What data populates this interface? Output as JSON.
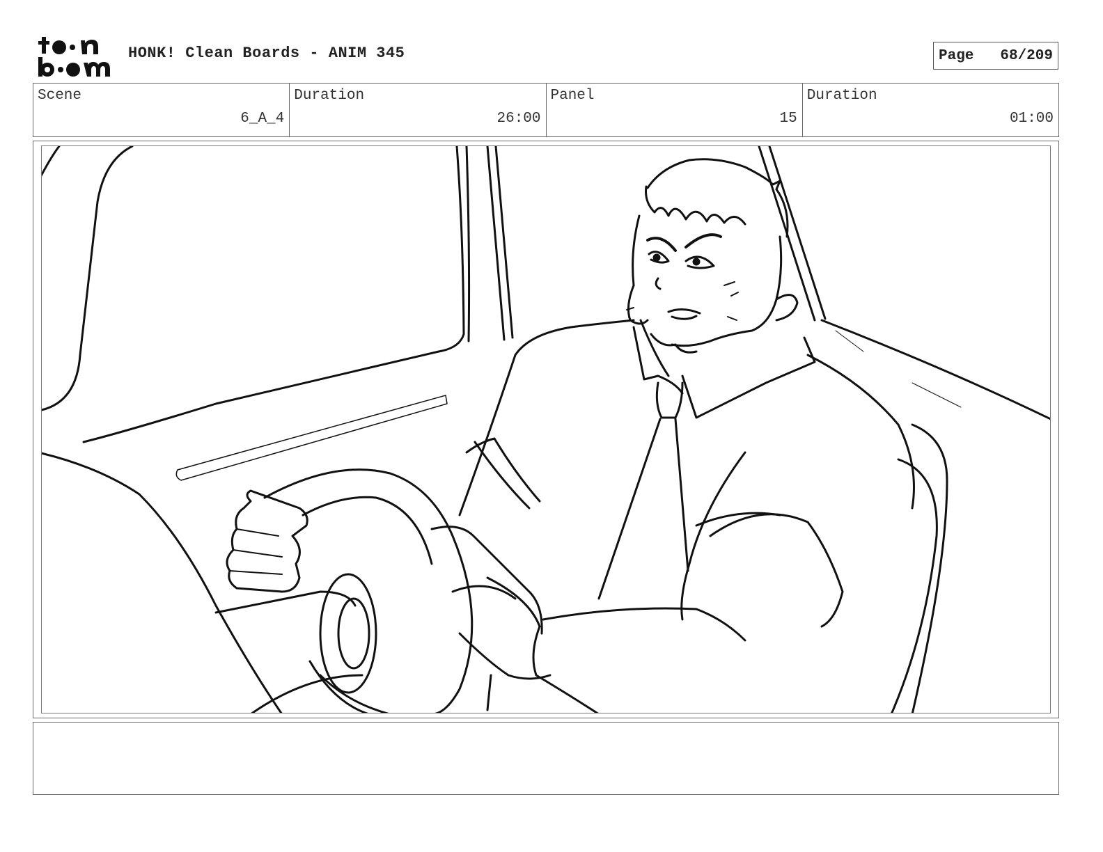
{
  "header": {
    "logo_text_top": "toon",
    "logo_text_bottom": "boom",
    "title": "HONK! Clean Boards - ANIM 345",
    "page_label": "Page",
    "page_number": "68/209"
  },
  "info": {
    "scene_label": "Scene",
    "scene_value": "6_A_4",
    "scene_duration_label": "Duration",
    "scene_duration_value": "26:00",
    "panel_label": "Panel",
    "panel_value": "15",
    "panel_duration_label": "Duration",
    "panel_duration_value": "01:00"
  },
  "notes": {
    "text": ""
  }
}
